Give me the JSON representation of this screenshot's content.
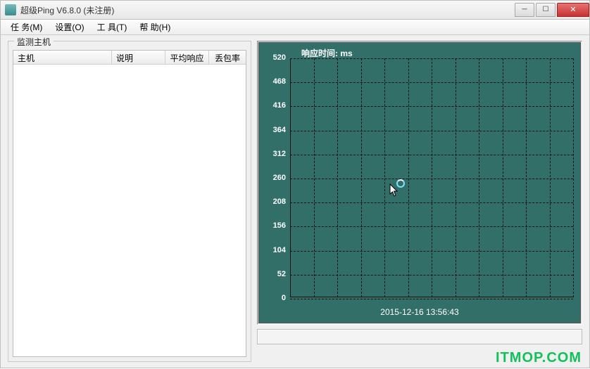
{
  "window": {
    "title": "超级Ping V6.8.0  (未注册)"
  },
  "menu": {
    "task": "任 务(M)",
    "config": "设置(O)",
    "tool": "工 具(T)",
    "help": "帮 助(H)"
  },
  "hosts": {
    "group_title": "监测主机",
    "columns": {
      "host": "主机",
      "desc": "说明",
      "avg": "平均响应",
      "loss": "丢包率"
    },
    "rows": []
  },
  "chart_data": {
    "type": "line",
    "title": "响应时间: ms",
    "x_caption": "2015-12-16  13:56:43",
    "xlabel": "",
    "ylabel": "",
    "ylim": [
      0,
      520
    ],
    "y_ticks": [
      0,
      52,
      104,
      156,
      208,
      260,
      312,
      364,
      416,
      468,
      520
    ],
    "x_grid_count": 12,
    "series": [
      {
        "name": "响应时间",
        "values": []
      }
    ]
  },
  "cursor": {
    "x_pct": 35,
    "y_pct": 52
  },
  "watermark": "ITMOP.COM"
}
